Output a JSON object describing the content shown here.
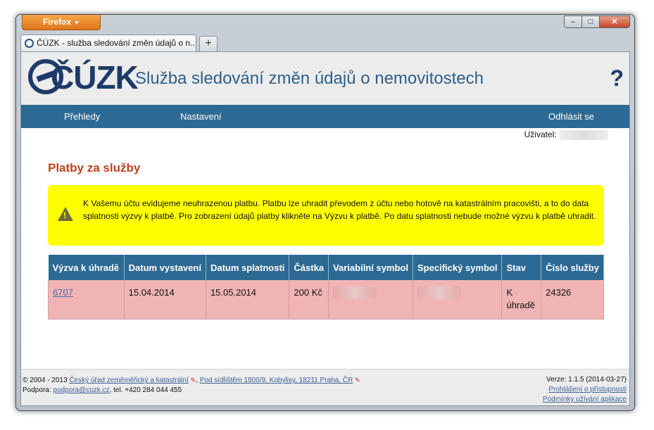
{
  "browser": {
    "menu_button": "Firefox",
    "tab_title": "ČÚZK - služba sledování změn údajů o n...",
    "new_tab": "+",
    "controls": {
      "minimize": "–",
      "maximize": "□",
      "close": "✕"
    }
  },
  "header": {
    "logo_text": "ČÚZK",
    "site_title": "Služba sledování změn údajů o nemovitostech",
    "help": "?"
  },
  "nav": {
    "overview": "Přehledy",
    "settings": "Nastavení",
    "logout": "Odhlásit se"
  },
  "user_label": "Uživatel:",
  "page": {
    "heading": "Platby za služby",
    "warning": "K Vašemu účtu evidujeme neuhrazenou platbu. Platbu lze uhradit převodem z účtu nebo hotově na katastrálním pracovišti, a to do data splatnosti výzvy k platbě. Pro zobrazení údajů platby klikněte na Výzvu k platbě. Po datu splatnosti nebude možné výzvu k platbě uhradit."
  },
  "table": {
    "columns": [
      "Výzva k úhradě",
      "Datum vystavení",
      "Datum splatnosti",
      "Částka",
      "Variabilní symbol",
      "Specifický symbol",
      "Stav",
      "Číslo služby"
    ],
    "row": {
      "invoice": "6707",
      "issued": "15.04.2014",
      "due": "15.05.2014",
      "amount": "200 Kč",
      "status": "K úhradě",
      "service_no": "24326"
    }
  },
  "footer": {
    "copyright": "© 2004 - 2013",
    "office_link": "Český úřad zeměměřický a katastrální",
    "address_link": "Pod sídlištěm 1800/9, Kobylisy, 18211 Praha, ČR",
    "support_label": "Podpora:",
    "support_email": "podpora@cuzk.cz",
    "phone": ", tel. +420 284 044 455",
    "version": "Verze: 1.1.5 (2014-03-27)",
    "accessibility_link": "Prohlášení o přístupnosti",
    "terms_link": "Podmínky užívání aplikace"
  }
}
